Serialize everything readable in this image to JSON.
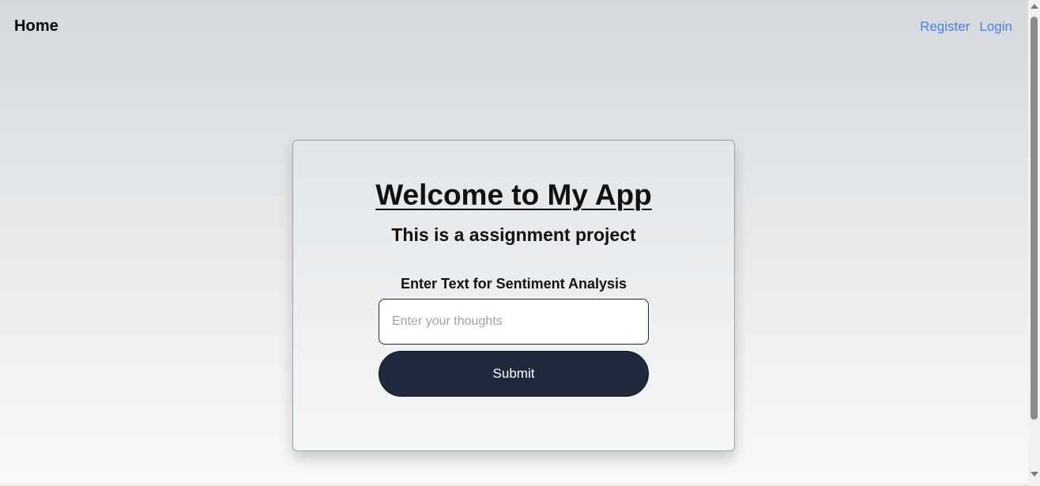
{
  "nav": {
    "home_label": "Home",
    "links": [
      {
        "label": "Register"
      },
      {
        "label": "Login"
      }
    ]
  },
  "card": {
    "title": "Welcome to My App",
    "subtitle": "This is a assignment project",
    "field_label": "Enter Text for Sentiment Analysis",
    "input": {
      "value": "",
      "placeholder": "Enter your thoughts"
    },
    "submit_label": "Submit"
  },
  "colors": {
    "link": "#4a7fe6",
    "button_bg": "#1f2a3c",
    "button_text": "#ffffff"
  },
  "icons": {
    "scroll_up": "triangle-up",
    "scroll_down": "triangle-down"
  }
}
